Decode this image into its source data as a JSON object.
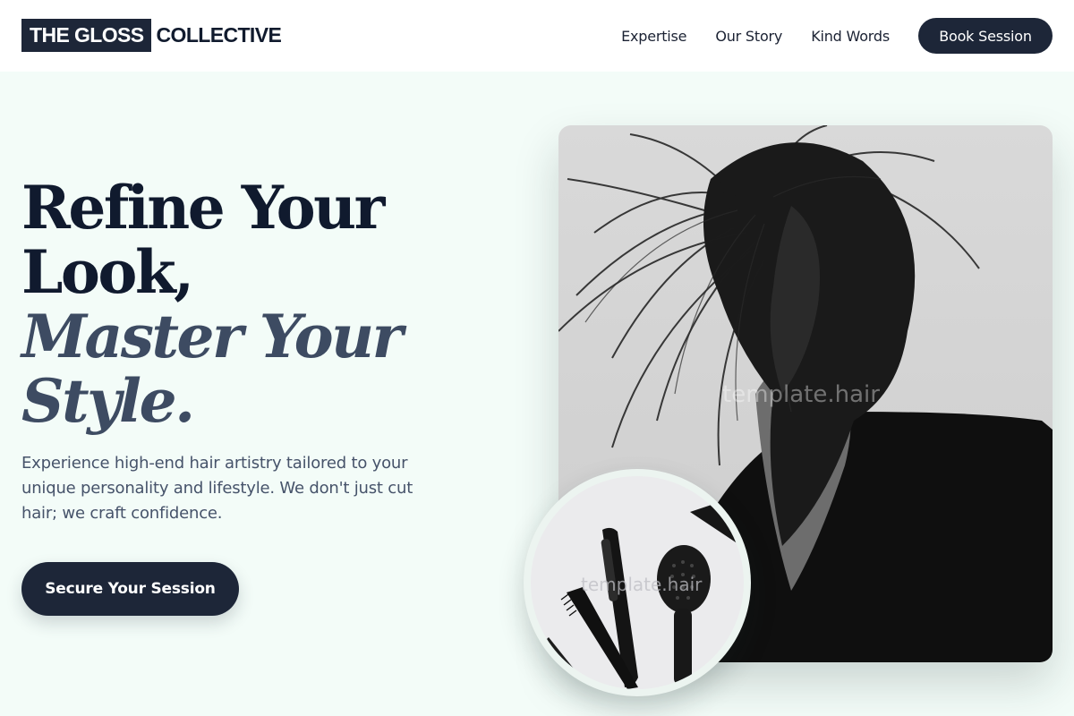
{
  "header": {
    "logo_box": "THE GLOSS",
    "logo_rest": "COLLECTIVE",
    "nav": [
      "Expertise",
      "Our Story",
      "Kind Words"
    ],
    "book_label": "Book Session"
  },
  "hero": {
    "headline_line1": "Refine Your",
    "headline_line2": "Look,",
    "headline_line3": "Master Your",
    "headline_line4": "Style.",
    "lead": "Experience high-end hair artistry tailored to your unique personality and lifestyle. We don't just cut hair; we craft confidence.",
    "cta_label": "Secure Your Session",
    "image_watermark": "template.hair",
    "tools_watermark": "template.hair"
  },
  "colors": {
    "page_bg": "#f3fcf8",
    "navy": "#1d2638",
    "accent_text": "#3d4b62"
  }
}
